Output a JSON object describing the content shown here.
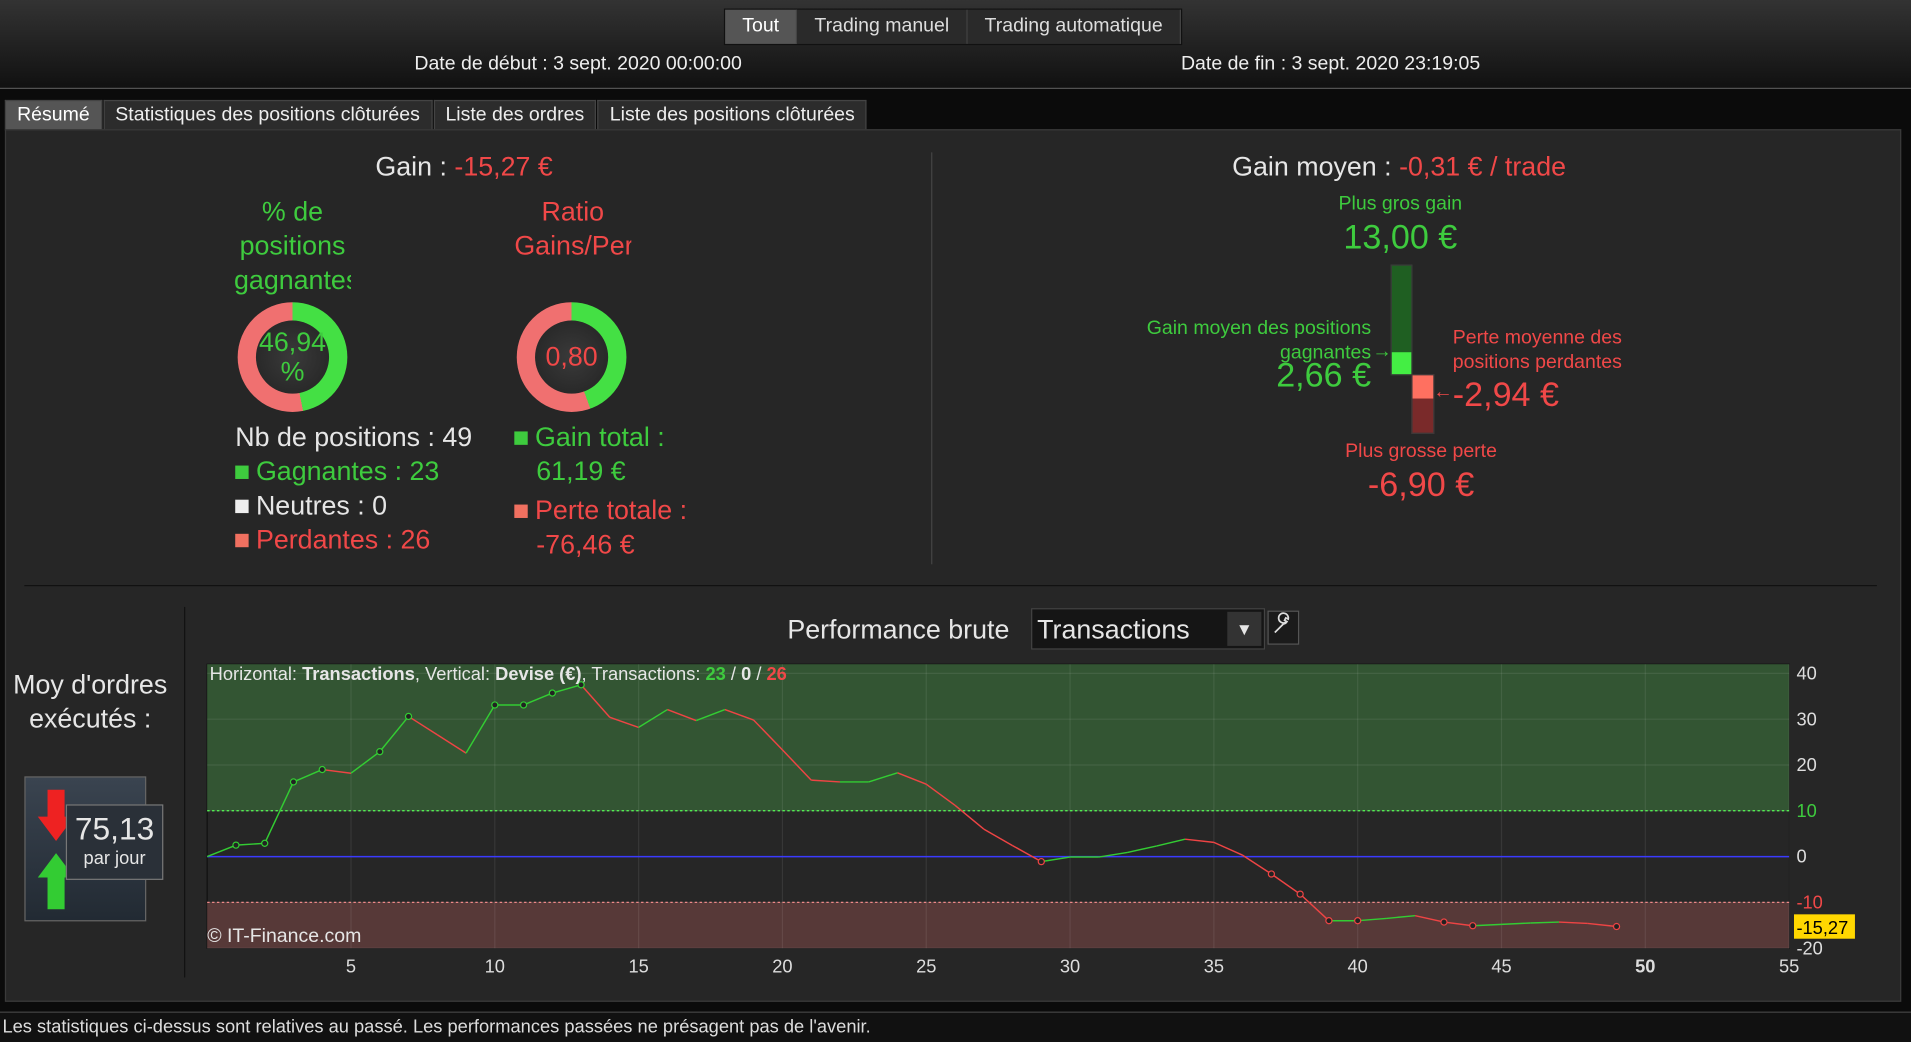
{
  "header": {
    "filters": [
      "Tout",
      "Trading manuel",
      "Trading automatique"
    ],
    "active_filter": "Tout",
    "start_date": "Date de début : 3 sept. 2020 00:00:00",
    "end_date": "Date de fin : 3 sept. 2020 23:19:05"
  },
  "tabs": [
    {
      "label": "Résumé",
      "active": true
    },
    {
      "label": "Statistiques des positions clôturées"
    },
    {
      "label": "Liste des ordres"
    },
    {
      "label": "Liste des positions clôturées"
    }
  ],
  "summary": {
    "gain_label": "Gain :",
    "gain_value": "-15,27 €",
    "pct_title": "% de positions gagnantes",
    "pct_value": "46,94 %",
    "pct_fraction": 0.4694,
    "ratio_title": "Ratio Gains/Pertes",
    "ratio_value": "0,80",
    "ratio_green_fraction": 0.4445,
    "nb_positions": "Nb de positions : 49",
    "gagnantes": "Gagnantes : 23",
    "neutres": "Neutres : 0",
    "perdantes": "Perdantes : 26",
    "gain_total_label": "Gain total :",
    "gain_total_value": "61,19 €",
    "perte_totale_label": "Perte totale :",
    "perte_totale_value": "-76,46 €"
  },
  "average": {
    "title_label": "Gain moyen :",
    "title_value": "-0,31 € / trade",
    "best_label": "Plus gros gain",
    "best_value": "13,00 €",
    "avg_win_label": "Gain moyen des positions gagnantes",
    "avg_win_value": "2,66 €",
    "avg_loss_label": "Perte moyenne des positions perdantes",
    "avg_loss_value": "-2,94 €",
    "worst_label": "Plus grosse perte",
    "worst_value": "-6,90 €"
  },
  "orders": {
    "label": "Moy d'ordres exécutés :",
    "value": "75,13",
    "unit": "par jour"
  },
  "performance": {
    "title": "Performance brute",
    "select_value": "Transactions",
    "settings_icon": "wrench-icon",
    "copyright": "© IT-Finance.com",
    "info_prefix": "Horizontal: ",
    "info_h": "Transactions",
    "info_mid": ", Vertical: ",
    "info_v": "Devise (€)",
    "info_tr": ", Transactions: ",
    "win": "23",
    "neutral": "0",
    "loss": "26",
    "sep": " / "
  },
  "colors": {
    "green": "#3ecb3e",
    "red": "#f04848",
    "zero_line": "#3a3aff",
    "current_badge": "#ffd700"
  },
  "chart_data": {
    "type": "line",
    "xlim": [
      0,
      55
    ],
    "ylim": [
      -20,
      42
    ],
    "x_ticks": [
      5,
      10,
      15,
      20,
      25,
      30,
      35,
      40,
      45,
      50,
      55
    ],
    "y_ticks": [
      40,
      30,
      20,
      10,
      0,
      -10,
      -20
    ],
    "upper_threshold": 10,
    "lower_threshold": -10,
    "current_value_label": "-15,27",
    "x": [
      0,
      1,
      2,
      3,
      4,
      5,
      6,
      7,
      8,
      9,
      10,
      11,
      12,
      13,
      14,
      15,
      16,
      17,
      18,
      19,
      20,
      21,
      22,
      23,
      24,
      25,
      26,
      27,
      28,
      29,
      30,
      31,
      32,
      33,
      34,
      35,
      36,
      37,
      38,
      39,
      40,
      41,
      42,
      43,
      44,
      45,
      46,
      47,
      48,
      49
    ],
    "y": [
      0,
      2.5,
      2.9,
      16.3,
      19.0,
      18.2,
      22.9,
      30.6,
      26.6,
      22.6,
      33.1,
      33.1,
      35.7,
      37.5,
      30.4,
      28.2,
      32.1,
      29.7,
      32.1,
      29.8,
      23.3,
      16.7,
      16.3,
      16.3,
      18.3,
      15.8,
      11.2,
      6.0,
      2.4,
      -1.1,
      -0.1,
      -0.1,
      0.9,
      2.3,
      3.8,
      3.1,
      0.3,
      -3.8,
      -8.2,
      -14.0,
      -14.0,
      -13.5,
      -12.9,
      -14.3,
      -15.1,
      -14.8,
      -14.5,
      -14.3,
      -14.6,
      -15.27
    ],
    "markers": [
      1,
      2,
      3,
      4,
      6,
      7,
      10,
      11,
      12,
      13,
      29,
      37,
      38,
      39,
      40,
      43,
      44,
      49
    ]
  },
  "footer": "Les statistiques ci-dessus sont relatives au passé. Les performances passées ne présagent pas de l'avenir."
}
